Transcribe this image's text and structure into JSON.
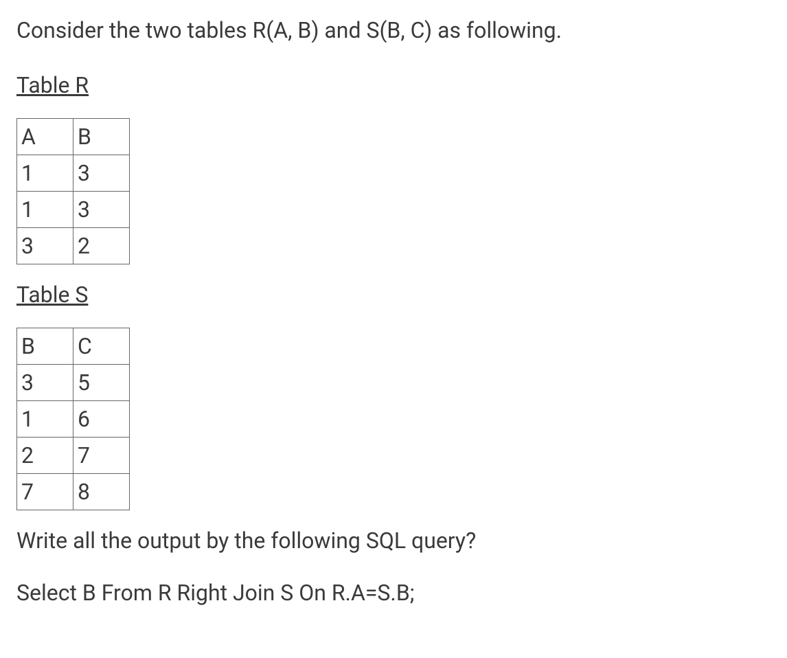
{
  "intro": "Consider the two tables R(A, B) and S(B, C) as following.",
  "tableR": {
    "heading": "Table R",
    "headers": [
      "A",
      "B"
    ],
    "rows": [
      [
        "1",
        "3"
      ],
      [
        "1",
        "3"
      ],
      [
        "3",
        "2"
      ]
    ]
  },
  "tableS": {
    "heading": "Table S",
    "headers": [
      "B",
      "C"
    ],
    "rows": [
      [
        "3",
        "5"
      ],
      [
        "1",
        "6"
      ],
      [
        "2",
        "7"
      ],
      [
        "7",
        "8"
      ]
    ]
  },
  "question": "Write all the output by the following SQL query?",
  "query": "Select B From R Right Join S On R.A=S.B;"
}
